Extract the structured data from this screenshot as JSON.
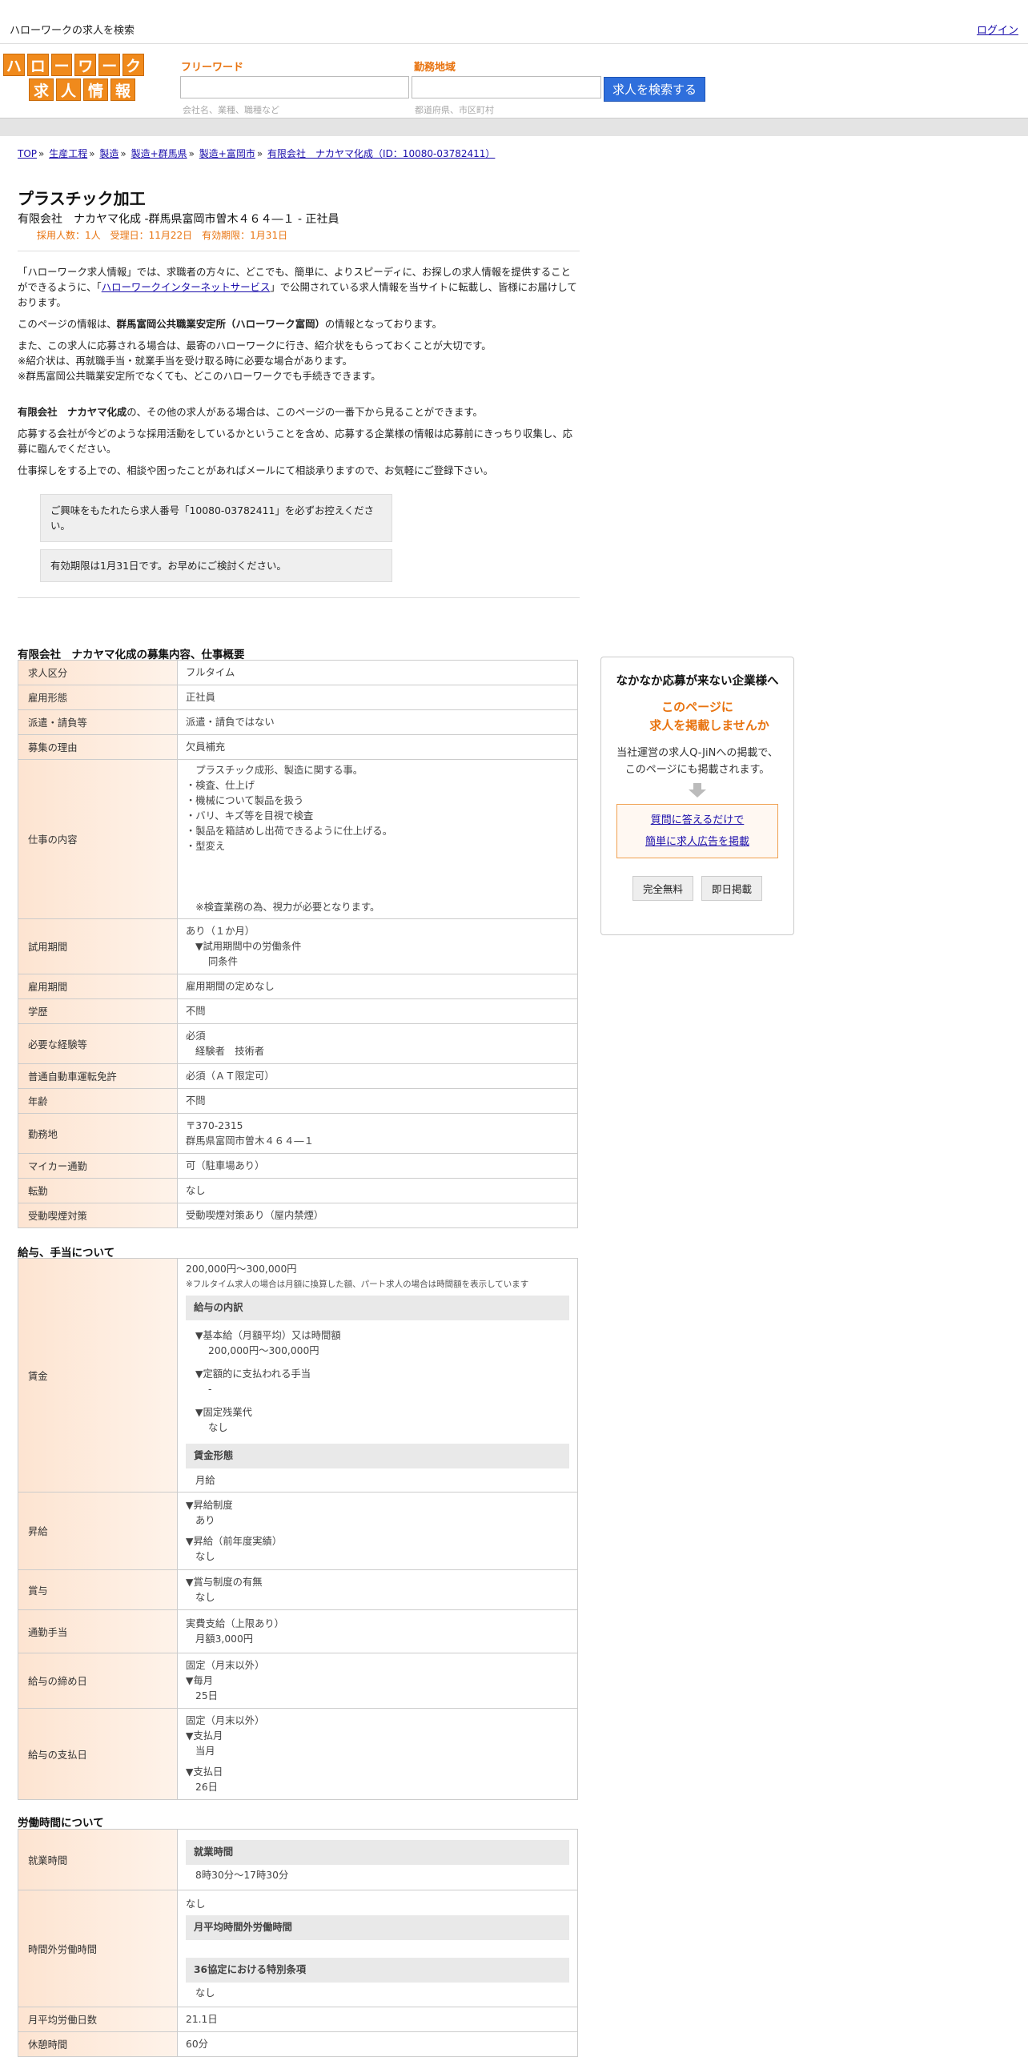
{
  "topbar": {
    "title": "ハローワークの求人を検索",
    "login": "ログイン"
  },
  "logo": {
    "row1": [
      "ハ",
      "ロ",
      "ー",
      "ワ",
      "ー",
      "ク"
    ],
    "row2": [
      "求",
      "人",
      "情",
      "報"
    ]
  },
  "search": {
    "freeword_label": "フリーワード",
    "freeword_placeholder": "会社名、業種、職種など",
    "area_label": "勤務地域",
    "area_placeholder": "都道府県、市区町村",
    "button": "求人を検索する"
  },
  "breadcrumb": {
    "items": [
      "TOP",
      "生産工程",
      "製造",
      "製造+群馬県",
      "製造+富岡市",
      "有限会社　ナカヤマ化成（ID：10080-03782411）"
    ],
    "sep": "»"
  },
  "job": {
    "title": "プラスチック加工",
    "subtitle": "有限会社　ナカヤマ化成 -群馬県富岡市曽木４６４―１ - 正社員",
    "meta": "採用人数：1人　受理日：11月22日　有効期限：1月31日"
  },
  "intro": {
    "p1_a": "「ハローワーク求人情報」では、求職者の方々に、どこでも、簡単に、よりスピーディに、お探しの求人情報を提供することができるように、「",
    "p1_link": "ハローワークインターネットサービス",
    "p1_b": "」で公開されている求人情報を当サイトに転載し、皆様にお届けしております。",
    "p2_a": "このページの情報は、",
    "p2_bold": "群馬富岡公共職業安定所（ハローワーク富岡）",
    "p2_b": "の情報となっております。",
    "p3_l1": "また、この求人に応募される場合は、最寄のハローワークに行き、紹介状をもらっておくことが大切です。",
    "p3_l2": "※紹介状は、再就職手当・就業手当を受け取る時に必要な場合があります。",
    "p3_l3": "※群馬富岡公共職業安定所でなくても、どこのハローワークでも手続きできます。",
    "p4_bold": "有限会社　ナカヤマ化成",
    "p4_b": "の、その他の求人がある場合は、このページの一番下から見ることができます。",
    "p5": "応募する会社が今どのような採用活動をしているかということを含め、応募する企業様の情報は応募前にきっちり収集し、応募に臨んでください。",
    "p6": "仕事探しをする上での、相談や困ったことがあればメールにて相談承りますので、お気軽にご登録下さい。"
  },
  "notices": [
    "ご興味をもたれたら求人番号「10080-03782411」を必ずお控えください。",
    "有効期限は1月31日です。お早めにご検討ください。"
  ],
  "section1": {
    "title": "有限会社　ナカヤマ化成の募集内容、仕事概要",
    "rows": {
      "kubun": [
        "求人区分",
        "フルタイム"
      ],
      "koyo": [
        "雇用形態",
        "正社員"
      ],
      "haken": [
        "派遣・請負等",
        "派遣・請負ではない"
      ],
      "riyu": [
        "募集の理由",
        "欠員補充"
      ],
      "naiyo_h": "仕事の内容",
      "naiyo": [
        "　プラスチック成形、製造に関する事。",
        "・検査、仕上げ",
        "・機械について製品を扱う",
        "・バリ、キズ等を目視で検査",
        "・製品を箱詰めし出荷できるように仕上げる。",
        "・型変え",
        "",
        "",
        "",
        "",
        "　※検査業務の為、視力が必要となります。"
      ],
      "shiyo_h": "試用期間",
      "shiyo": [
        "あり（１か月）",
        "▼試用期間中の労働条件",
        "同条件"
      ],
      "kikan": [
        "雇用期間",
        "雇用期間の定めなし"
      ],
      "gakureki": [
        "学歴",
        "不問"
      ],
      "keiken_h": "必要な経験等",
      "keiken": [
        "必須",
        "経験者　技術者"
      ],
      "menkyo": [
        "普通自動車運転免許",
        "必須（ＡＴ限定可）"
      ],
      "nenrei": [
        "年齢",
        "不問"
      ],
      "kinmuchi_h": "勤務地",
      "kinmuchi": [
        "〒370-2315",
        "群馬県富岡市曽木４６４―１"
      ],
      "mycar": [
        "マイカー通勤",
        "可（駐車場あり）"
      ],
      "tenkin": [
        "転勤",
        "なし"
      ],
      "kitsuen": [
        "受動喫煙対策",
        "受動喫煙対策あり（屋内禁煙）"
      ]
    }
  },
  "section2": {
    "title": "給与、手当について",
    "chingin_h": "賃金",
    "chingin_range": "200,000円〜300,000円",
    "chingin_note": "※フルタイム求人の場合は月額に換算した額、パート求人の場合は時間額を表示しています",
    "uchiwake_h": "給与の内訳",
    "kihon_label": "▼基本給（月額平均）又は時間額",
    "kihon_value": "200,000円〜300,000円",
    "teigaku_label": "▼定額的に支払われる手当",
    "teigaku_value": "-",
    "kotei_label": "▼固定残業代",
    "kotei_value": "なし",
    "keitai_h": "賃金形態",
    "keitai_value": "月給",
    "shokyu_h": "昇給",
    "shokyu": [
      "▼昇給制度",
      "あり",
      "▼昇給（前年度実績）",
      "なし"
    ],
    "shoyo_h": "賞与",
    "shoyo": [
      "▼賞与制度の有無",
      "なし"
    ],
    "tsukin_h": "通勤手当",
    "tsukin": [
      "実費支給（上限あり）",
      "月額3,000円"
    ],
    "shime_h": "給与の締め日",
    "shime": [
      "固定（月末以外）",
      "▼毎月",
      "25日"
    ],
    "shiharai_h": "給与の支払日",
    "shiharai": [
      "固定（月末以外）",
      "▼支払月",
      "当月",
      "▼支払日",
      "26日"
    ]
  },
  "section3": {
    "title": "労働時間について",
    "shugyo_h": "就業時間",
    "shugyo_sub": "就業時間",
    "shugyo_value": "8時30分〜17時30分",
    "jikangai_h": "時間外労働時間",
    "jikangai_value": "なし",
    "heikin_sub": "月平均時間外労働時間",
    "kyotei_sub": "36協定における特別条項",
    "kyotei_value": "なし",
    "nissu": [
      "月平均労働日数",
      "21.1日"
    ],
    "kyukei": [
      "休憩時間",
      "60分"
    ]
  },
  "side": {
    "title": "なかなか応募が来ない企業様へ",
    "offer_l1": "このページに",
    "offer_l2": "求人を掲載しませんか",
    "desc_l1": "当社運営の求人Q-JiNへの掲載で、",
    "desc_l2": "このページにも掲載されます。",
    "link_l1": "質問に答えるだけで",
    "link_l2": "簡単に求人広告を掲載",
    "btn1": "完全無料",
    "btn2": "即日掲載"
  },
  "colors": {
    "accent_orange": "#e8730f",
    "logo_orange": "#f08a1c",
    "search_blue": "#2f6fdc",
    "header_cell": "#fde4d1"
  }
}
